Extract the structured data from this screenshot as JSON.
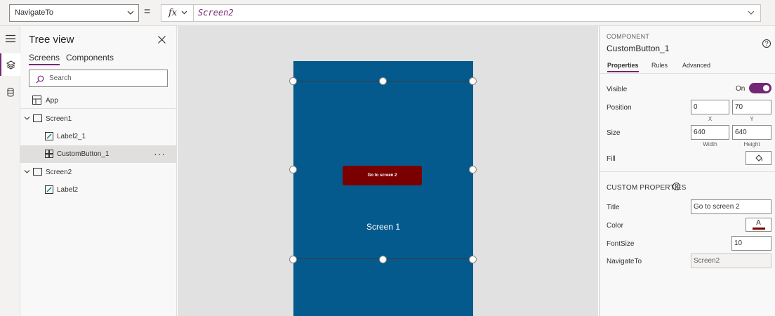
{
  "formula_bar": {
    "property": "NavigateTo",
    "equals": "=",
    "fx": "fx",
    "formula": "Screen2"
  },
  "rail": {
    "items": [
      "hamburger-icon",
      "layers-icon",
      "database-icon"
    ],
    "active": "layers-icon"
  },
  "tree": {
    "title": "Tree view",
    "tabs": [
      {
        "label": "Screens",
        "active": true
      },
      {
        "label": "Components",
        "active": false
      }
    ],
    "search_placeholder": "Search",
    "app_label": "App",
    "items": [
      {
        "label": "Screen1",
        "type": "screen",
        "expanded": true
      },
      {
        "label": "Label2_1",
        "type": "label"
      },
      {
        "label": "CustomButton_1",
        "type": "component",
        "selected": true,
        "more": "···"
      },
      {
        "label": "Screen2",
        "type": "screen",
        "expanded": true
      },
      {
        "label": "Label2",
        "type": "label"
      }
    ]
  },
  "canvas": {
    "button_text": "Go to screen 2",
    "screen_label": "Screen 1",
    "screen_color": "#045a8d",
    "button_color": "#7a0000"
  },
  "properties": {
    "kicker": "COMPONENT",
    "name": "CustomButton_1",
    "help": "?",
    "tabs": [
      {
        "label": "Properties",
        "active": true
      },
      {
        "label": "Rules",
        "active": false
      },
      {
        "label": "Advanced",
        "active": false
      }
    ],
    "visible": {
      "label": "Visible",
      "state": "On"
    },
    "position": {
      "label": "Position",
      "x": "0",
      "y": "70",
      "x_label": "X",
      "y_label": "Y"
    },
    "size": {
      "label": "Size",
      "width": "640",
      "height": "640",
      "width_label": "Width",
      "height_label": "Height"
    },
    "fill": {
      "label": "Fill"
    },
    "custom_section": "CUSTOM PROPERTIES",
    "title": {
      "label": "Title",
      "value": "Go to screen 2"
    },
    "color": {
      "label": "Color",
      "glyph": "A",
      "swatch": "#7a0000"
    },
    "fontsize": {
      "label": "FontSize",
      "value": "10"
    },
    "navigate": {
      "label": "NavigateTo",
      "value": "Screen2"
    }
  },
  "colors": {
    "accent": "#742774"
  }
}
